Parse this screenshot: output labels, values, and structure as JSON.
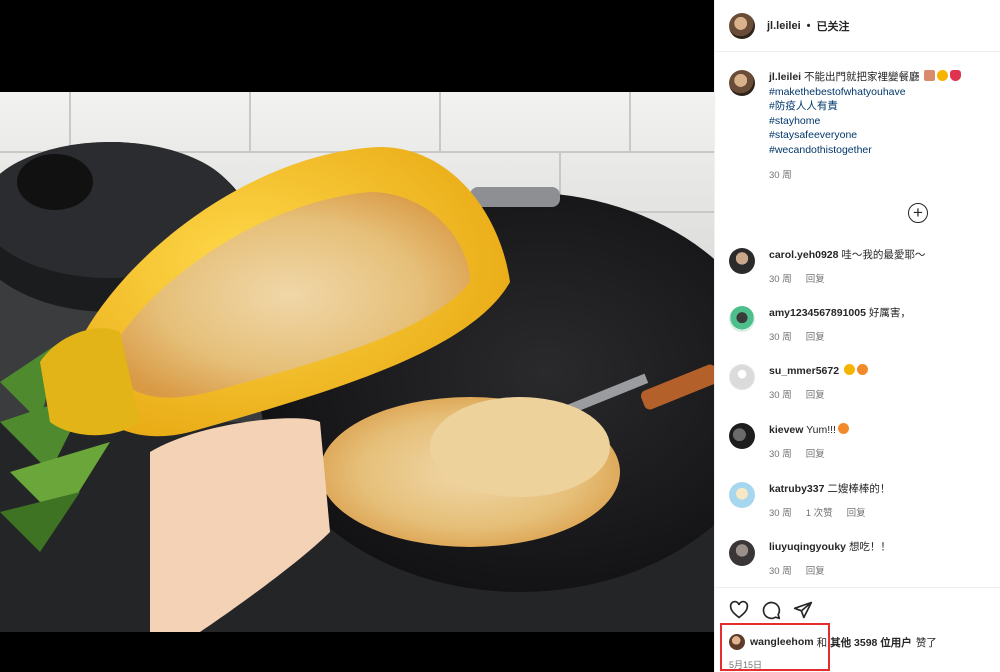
{
  "post": {
    "username": "jl.leilei",
    "follow_status": "已关注",
    "caption": "不能出門就把家裡變餐廳",
    "hashtags": [
      "#makethebestofwhatyouhave",
      "#防疫人人有責",
      "#stayhome",
      "#staysafeeveryone",
      "#wecandothistogether"
    ],
    "caption_time": "30 周"
  },
  "comments": [
    {
      "user": "carol.yeh0928",
      "text": "哇～我的最愛耶～",
      "time": "30 周",
      "reply": "回复",
      "likes": ""
    },
    {
      "user": "amy1234567891005",
      "text": "好厲害，",
      "time": "30 周",
      "reply": "回复",
      "likes": ""
    },
    {
      "user": "su_mmer5672",
      "text": "",
      "time": "30 周",
      "reply": "回复",
      "likes": ""
    },
    {
      "user": "kievew",
      "text": "Yum!!!",
      "time": "30 周",
      "reply": "回复",
      "likes": ""
    },
    {
      "user": "katruby337",
      "text": "二嫂棒棒的！",
      "time": "30 周",
      "reply": "回复",
      "likes": "1 次赞"
    },
    {
      "user": "liuyuqingyouky",
      "text": "想吃！！",
      "time": "30 周",
      "reply": "回复",
      "likes": ""
    }
  ],
  "likes_summary": {
    "user": "wangleehom",
    "connector": "和",
    "others": "其他 3598 位用户",
    "suffix": "赞了"
  },
  "post_date": "5月15日",
  "icons": [
    "heart-icon",
    "comment-icon",
    "share-icon",
    "add-comment-icon"
  ],
  "colors": {
    "link": "#00376b",
    "muted": "#737373",
    "highlight": "#e52d2d"
  }
}
